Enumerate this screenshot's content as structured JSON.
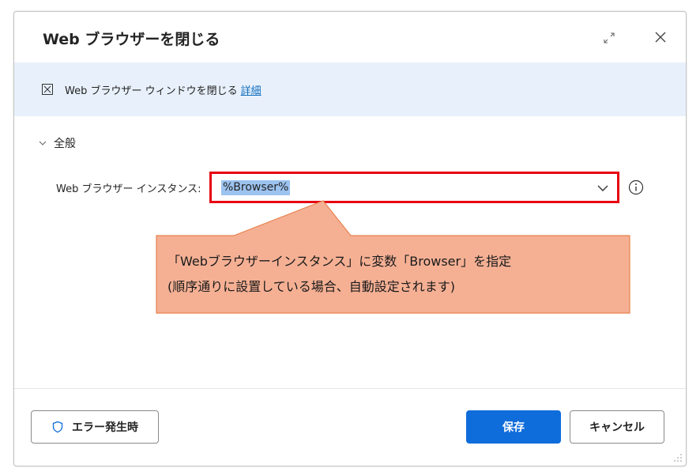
{
  "dialog": {
    "title": "Web ブラウザーを閉じる",
    "info": {
      "text": "Web ブラウザー ウィンドウを閉じる",
      "link": "詳細"
    },
    "section": {
      "label": "全般"
    },
    "field": {
      "label": "Web ブラウザー インスタンス:",
      "value": "%Browser%"
    },
    "buttons": {
      "on_error": "エラー発生時",
      "save": "保存",
      "cancel": "キャンセル"
    }
  },
  "annotation": {
    "lines": [
      "「Webブラウザーインスタンス」に変数「Browser」を指定",
      "(順序通りに設置している場合、自動設定されます)"
    ],
    "fill_color": "#f5b094",
    "border_color": "#e8834e",
    "highlight_color": "#e60012"
  },
  "colors": {
    "accent": "#0f6cdb",
    "info_bar": "#e8f1fb",
    "link": "#0f6cbd"
  }
}
